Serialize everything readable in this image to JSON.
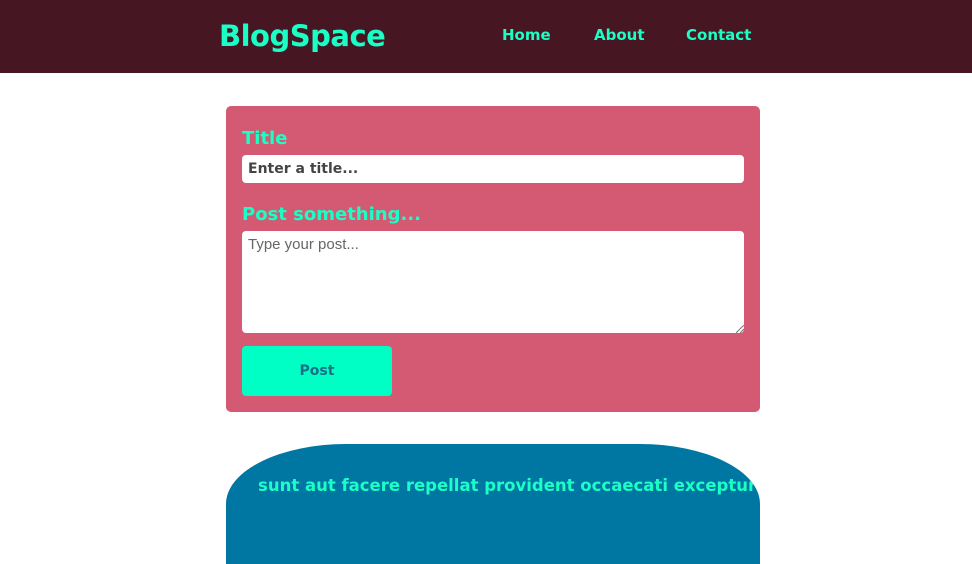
{
  "header": {
    "logo": "BlogSpace",
    "nav": [
      {
        "label": "Home"
      },
      {
        "label": "About"
      },
      {
        "label": "Contact"
      }
    ]
  },
  "form": {
    "title_label": "Title",
    "title_placeholder": "Enter a title...",
    "title_value": "",
    "post_label": "Post something...",
    "post_placeholder": "Type your post...",
    "post_value": "",
    "submit_label": "Post"
  },
  "posts": [
    {
      "title": "sunt aut facere repellat provident occaecati excepturi"
    }
  ],
  "colors": {
    "header_bg": "#461722",
    "accent": "#1affc5",
    "form_bg": "#d35a72",
    "button_bg": "#00ffc5",
    "post_card_bg": "#0077a3"
  }
}
